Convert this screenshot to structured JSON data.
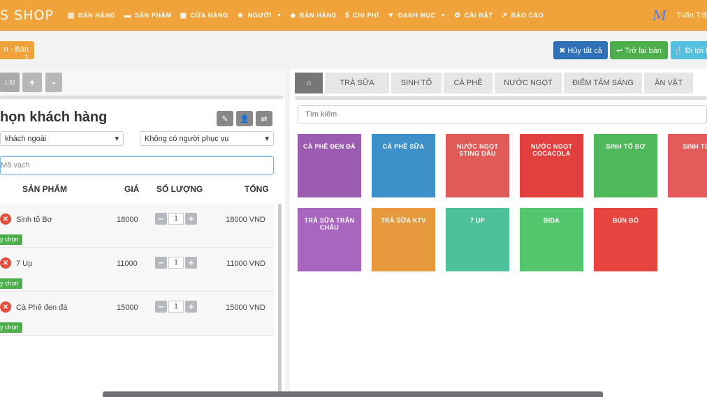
{
  "brand": "S SHOP",
  "nav": [
    {
      "icon": "▤",
      "label": "BÁN HÀNG",
      "caret": false
    },
    {
      "icon": "▬",
      "label": "SẢN PHẨM",
      "caret": false
    },
    {
      "icon": "▣",
      "label": "CỬA HÀNG",
      "caret": false
    },
    {
      "icon": "☻",
      "label": "NGƯỜI",
      "caret": true
    },
    {
      "icon": "◈",
      "label": "BÁN HÀNG",
      "caret": false
    },
    {
      "icon": "$",
      "label": "CHI PHÍ",
      "caret": false
    },
    {
      "icon": "▼",
      "label": "DANH MỤC",
      "caret": true
    },
    {
      "icon": "⚙",
      "label": "CÀI ĐẶT",
      "caret": false
    },
    {
      "icon": "↗",
      "label": "BÁO CÁO",
      "caret": false
    }
  ],
  "user": {
    "logo": "M",
    "name": "Tuấn Trầ"
  },
  "table_badge": "n - Bàn 1",
  "actions": {
    "cancel": "✖ Hủy tất cả",
    "back": "↩ Trở lại bàn",
    "go": "🍴 Đi tới b"
  },
  "toolbar": {
    "time": "1:32",
    "plus": "+",
    "minus": "-"
  },
  "customer": {
    "title": "họn khách hàng",
    "customer_select": "khách ngoài",
    "staff_select": "Không có người phục vụ",
    "barcode_placeholder": "Mã vạch"
  },
  "table_headers": {
    "product": "SẢN PHẨM",
    "price": "GIÁ",
    "qty": "SỐ LƯỢNG",
    "total": "TỔNG"
  },
  "orders": [
    {
      "name": "Sinh tố Bơ",
      "price": "18000",
      "qty": "1",
      "total": "18000 VND",
      "pick": "y chọn"
    },
    {
      "name": "7 Up",
      "price": "11000",
      "qty": "1",
      "total": "11000 VND",
      "pick": "y chọn"
    },
    {
      "name": "Cà Phê đen đá",
      "price": "15000",
      "qty": "1",
      "total": "15000 VND",
      "pick": "y chọn"
    }
  ],
  "tabs": [
    "TRÀ SỮA",
    "SINH TỐ",
    "CÀ PHÊ",
    "NƯỚC NGỌT",
    "ĐIỂM TÂM SÁNG",
    "ĂN VẶT"
  ],
  "search_placeholder": "Tìm kiếm",
  "products": [
    {
      "label": "CÀ PHÊ ĐEN ĐÁ",
      "color": "#9a5bb0"
    },
    {
      "label": "CÀ PHÊ SỮA",
      "color": "#3d91c8"
    },
    {
      "label": "NƯỚC NGỌT STING DÂU",
      "color": "#e05a57"
    },
    {
      "label": "NƯỚC NGỌT COCACOLA",
      "color": "#e2403f"
    },
    {
      "label": "SINH TỐ BƠ",
      "color": "#4fb85a"
    },
    {
      "label": "SINH TỐ D",
      "color": "#e55a5a"
    },
    {
      "label": "TRÀ SỮA TRÂN CHÂU",
      "color": "#a866bf"
    },
    {
      "label": "TRÀ SỮA KTV",
      "color": "#e69a3d"
    },
    {
      "label": "7 UP",
      "color": "#4fc19a"
    },
    {
      "label": "BIDA",
      "color": "#54c66e"
    },
    {
      "label": "BÚN BÒ",
      "color": "#e5443f"
    }
  ]
}
